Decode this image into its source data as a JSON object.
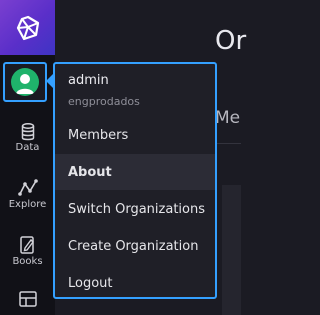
{
  "nav": {
    "items": [
      {
        "label": "Data",
        "icon": "database-icon"
      },
      {
        "label": "Explore",
        "icon": "graph-icon"
      },
      {
        "label": "Books",
        "icon": "notebook-icon"
      },
      {
        "label": "",
        "icon": "dashboard-grid-icon"
      }
    ]
  },
  "main": {
    "title": "Or",
    "tab": "Me"
  },
  "user_menu": {
    "user_name": "admin",
    "org_name": "engprodados",
    "items": [
      {
        "label": "Members"
      },
      {
        "label": "About",
        "active": true
      },
      {
        "label": "Switch Organizations"
      },
      {
        "label": "Create Organization"
      },
      {
        "label": "Logout"
      }
    ]
  },
  "colors": {
    "accent": "#34a0ff",
    "logo_gradient": [
      "#7a3fd0",
      "#3e34c4"
    ],
    "avatar": "#1fb36b"
  }
}
